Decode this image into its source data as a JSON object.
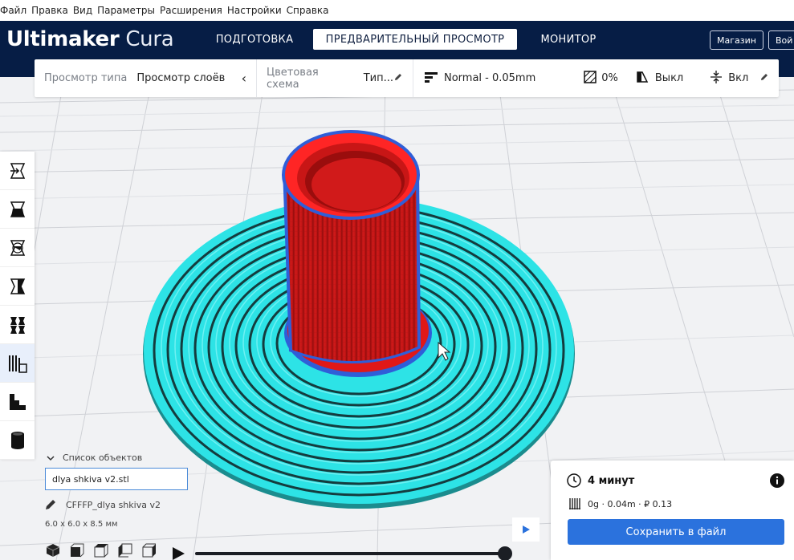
{
  "menu": [
    "Файл",
    "Правка",
    "Вид",
    "Параметры",
    "Расширения",
    "Настройки",
    "Справка"
  ],
  "header": {
    "logo_bold": "Ultimaker",
    "logo_light": "Cura",
    "stages": [
      "ПОДГОТОВКА",
      "ПРЕДВАРИТЕЛЬНЫЙ ПРОСМОТР",
      "МОНИТОР"
    ],
    "active_stage": "ПРЕДВАРИТЕЛЬНЫЙ ПРОСМОТР",
    "marketplace_label": "Магазин",
    "signin_label": "Вой"
  },
  "toolbar": {
    "view_type_label": "Просмотр типа",
    "view_type_value": "Просмотр слоёв",
    "color_scheme_label": "Цветовая схема",
    "color_scheme_value": "Тип...",
    "profile": "Normal - 0.05mm",
    "infill": "0%",
    "support": "Выкл",
    "adhesion": "Вкл"
  },
  "tools": [
    "move-tool",
    "scale-tool",
    "rotate-tool",
    "mirror-tool",
    "per-model-settings-tool",
    "support-blocker-tool",
    "stairs-tool",
    "cylinder-tool"
  ],
  "object_list": {
    "title": "Список объектов",
    "file": "dlya shkiva v2.stl",
    "job_name": "CFFFP_dlya shkiva v2",
    "dimensions": "6.0 x 6.0 x 8.5 мм"
  },
  "summary": {
    "time": "4 минут",
    "material": "0g · 0.04m · ₽ 0.13",
    "save_label": "Сохранить в файл"
  },
  "layer_slider": {
    "value": 1.0
  },
  "colors": {
    "header_bg": "#061d45",
    "accent": "#2b72dd",
    "skirt": "#27e6e8",
    "wall": "#e01e1e"
  }
}
